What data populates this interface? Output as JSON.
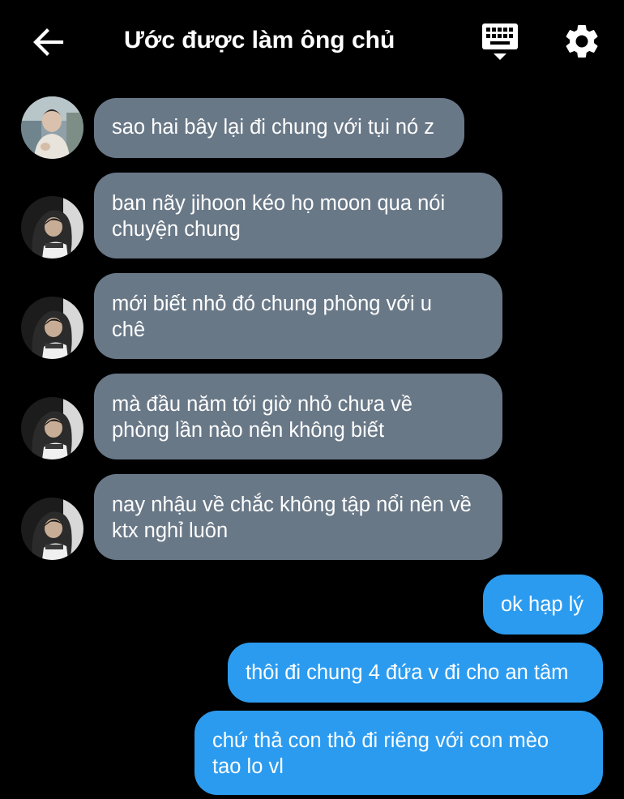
{
  "header": {
    "title": "Ước được làm ông chủ",
    "back_icon": "arrow-left-icon",
    "keyboard_icon": "keyboard-icon",
    "settings_icon": "gear-icon"
  },
  "colors": {
    "background": "#000000",
    "incoming_bubble": "#697887",
    "outgoing_bubble": "#2b9bef",
    "text": "#ffffff"
  },
  "messages": [
    {
      "side": "incoming",
      "avatar": "avatar-light-photo",
      "lines": [
        "sao hai bây lại đi chung với tụi nó z"
      ]
    },
    {
      "side": "incoming",
      "avatar": "avatar-hoodie-photo",
      "lines": [
        "ban nãy jihoon kéo họ moon qua nói",
        "chuyện chung"
      ]
    },
    {
      "side": "incoming",
      "avatar": "avatar-hoodie-photo",
      "lines": [
        "mới biết nhỏ đó chung phòng với u",
        "chê"
      ]
    },
    {
      "side": "incoming",
      "avatar": "avatar-hoodie-photo",
      "lines": [
        "mà đầu năm tới giờ nhỏ chưa về",
        "phòng lần nào nên không biết"
      ]
    },
    {
      "side": "incoming",
      "avatar": "avatar-hoodie-photo",
      "lines": [
        "nay nhậu về chắc không tập nổi nên về",
        "ktx nghỉ luôn"
      ]
    },
    {
      "side": "outgoing",
      "lines": [
        "ok hạp lý"
      ]
    },
    {
      "side": "outgoing",
      "lines": [
        "thôi đi chung 4 đứa v đi cho an tâm"
      ]
    },
    {
      "side": "outgoing",
      "lines": [
        "chứ thả con thỏ đi riêng với con mèo",
        "tao lo vl"
      ]
    }
  ]
}
